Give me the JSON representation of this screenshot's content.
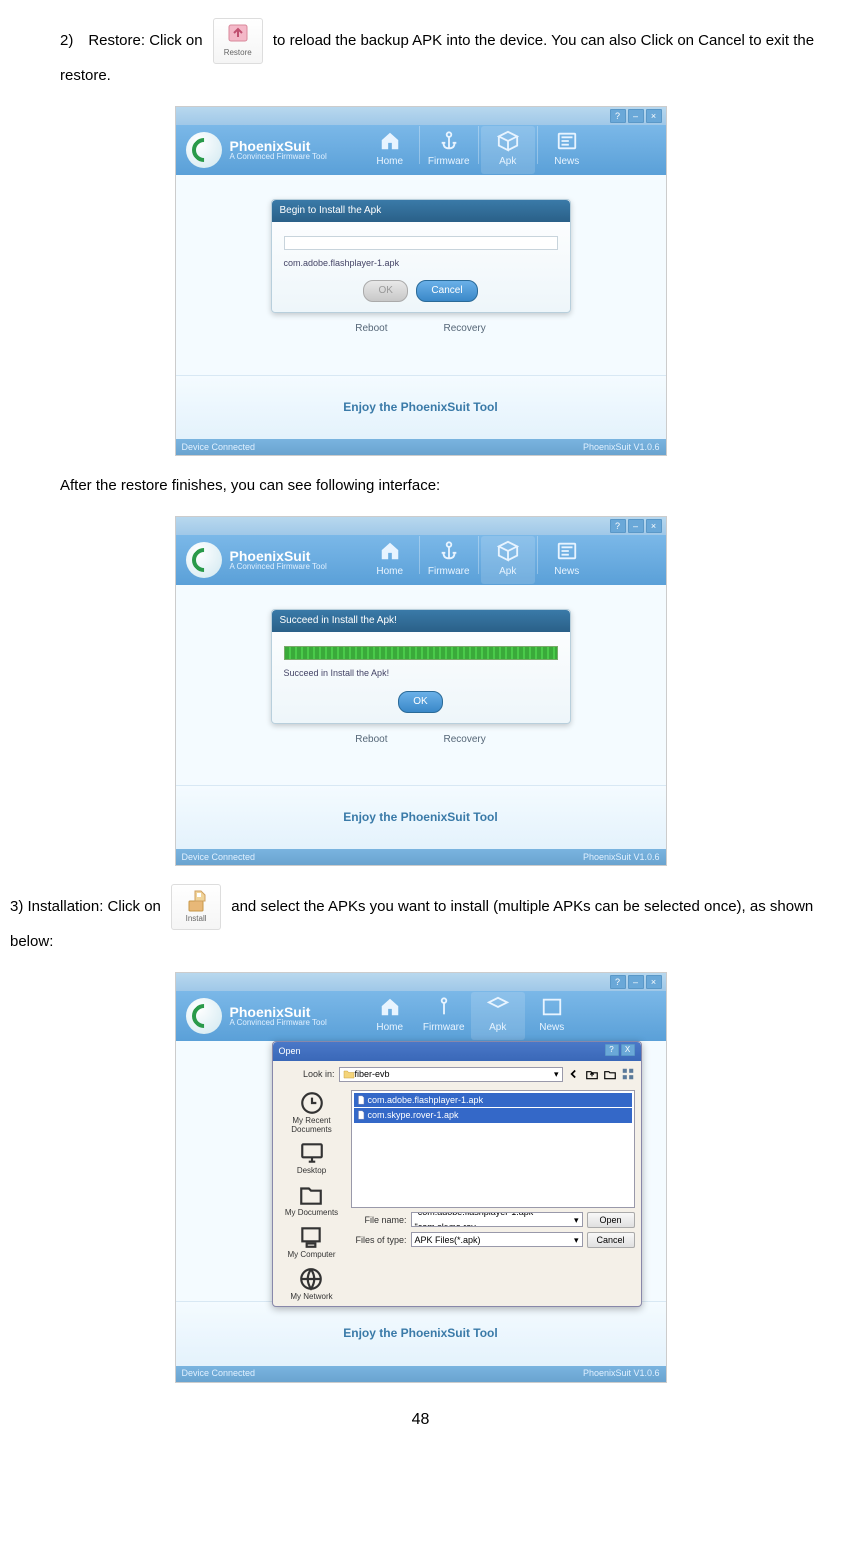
{
  "doc": {
    "step2_prefix": "2) Restore: Click on",
    "step2_suffix": "to reload the backup APK into the device. You can also Click on Cancel to exit the restore.",
    "after_restore": "After the restore finishes, you can see following interface:",
    "step3_prefix": "3) Installation: Click on",
    "step3_suffix": "and select the APKs you want to install (multiple APKs can be selected once), as shown below:",
    "page_number": "48",
    "restore_icon_label": "Restore",
    "install_icon_label": "Install"
  },
  "app": {
    "brand": "PhoenixSuit",
    "tagline": "A Convinced Firmware Tool",
    "nav": {
      "home": "Home",
      "firmware": "Firmware",
      "apk": "Apk",
      "news": "News"
    },
    "footer": "Enjoy the PhoenixSuit Tool",
    "status_left": "Device Connected",
    "status_right": "PhoenixSuit V1.0.6",
    "reboot": "Reboot",
    "recovery": "Recovery"
  },
  "dlg1": {
    "title": "Begin to Install the Apk",
    "filename": "com.adobe.flashplayer-1.apk",
    "ok": "OK",
    "cancel": "Cancel"
  },
  "dlg2": {
    "title": "Succeed in Install the Apk!",
    "msg": "Succeed in Install the Apk!",
    "ok": "OK"
  },
  "open": {
    "title": "Open",
    "lookin": "Look in:",
    "folder": "fiber-evb",
    "file1": "com.adobe.flashplayer-1.apk",
    "file2": "com.skype.rover-1.apk",
    "side": {
      "recent": "My Recent Documents",
      "desktop": "Desktop",
      "mydocs": "My Documents",
      "mycomp": "My Computer",
      "network": "My Network"
    },
    "filename_label": "File name:",
    "filename_value": "\"com.adobe.flashplayer-1.apk\" \"com.skype.rov",
    "filetype_label": "Files of type:",
    "filetype_value": "APK Files(*.apk)",
    "open_btn": "Open",
    "cancel_btn": "Cancel",
    "help": "?",
    "close": "X"
  }
}
